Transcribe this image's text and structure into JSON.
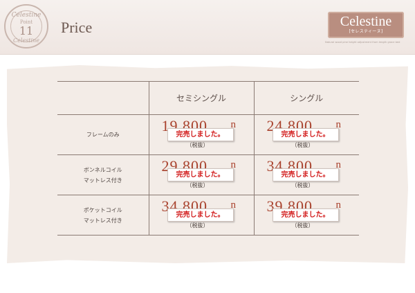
{
  "badge": {
    "top_text": "Celestine",
    "point_label": "Point",
    "number": "11",
    "bottom_text": "Celestine"
  },
  "header": {
    "title": "Price",
    "logo_name": "Celestine",
    "logo_sub": "[セレスティーヌ]",
    "tagline": "Natural wood pine height adjustment from length grace bed"
  },
  "table": {
    "columns": [
      "セミシングル",
      "シングル"
    ],
    "rows": [
      {
        "label": [
          "フレームのみ"
        ],
        "cells": [
          {
            "price": "19,800",
            "unit": "n",
            "tax": "（税抜）",
            "sold_out": "完売しました。"
          },
          {
            "price": "24,800",
            "unit": "n",
            "tax": "（税抜）",
            "sold_out": "完売しました。"
          }
        ]
      },
      {
        "label": [
          "ボンネルコイル",
          "マットレス付き"
        ],
        "cells": [
          {
            "price": "29,800",
            "unit": "n",
            "tax": "（税抜）",
            "sold_out": "完売しました。"
          },
          {
            "price": "34,800",
            "unit": "n",
            "tax": "（税抜）",
            "sold_out": "完売しました。"
          }
        ]
      },
      {
        "label": [
          "ポケットコイル",
          "マットレス付き"
        ],
        "cells": [
          {
            "price": "34,800",
            "unit": "n",
            "tax": "（税抜）",
            "sold_out": "完売しました。"
          },
          {
            "price": "39,800",
            "unit": "n",
            "tax": "（税抜）",
            "sold_out": "完売しました。"
          }
        ]
      }
    ]
  },
  "colors": {
    "price_red": "#a8412c",
    "sold_out_red": "#d21a1a",
    "logo_bg": "#b98e80"
  }
}
